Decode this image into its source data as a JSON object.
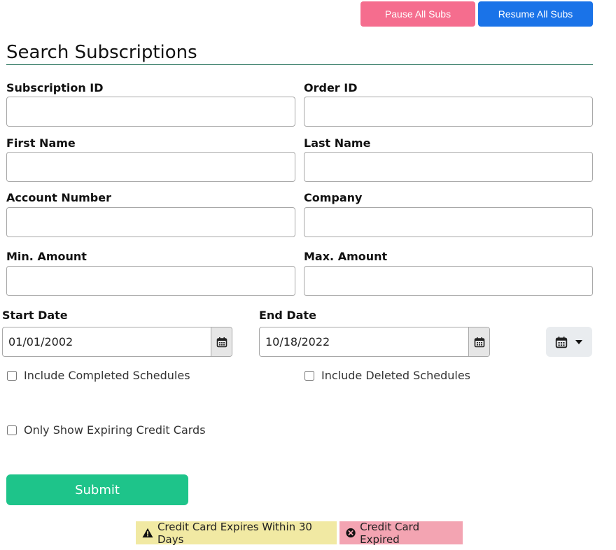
{
  "header": {
    "pause_label": "Pause All Subs",
    "resume_label": "Resume All Subs",
    "title": "Search Subscriptions"
  },
  "fields": {
    "subscription_id": {
      "label": "Subscription ID",
      "value": ""
    },
    "order_id": {
      "label": "Order ID",
      "value": ""
    },
    "first_name": {
      "label": "First Name",
      "value": ""
    },
    "last_name": {
      "label": "Last Name",
      "value": ""
    },
    "account_number": {
      "label": "Account Number",
      "value": ""
    },
    "company": {
      "label": "Company",
      "value": ""
    },
    "min_amount": {
      "label": "Min. Amount",
      "value": ""
    },
    "max_amount": {
      "label": "Max. Amount",
      "value": ""
    },
    "start_date": {
      "label": "Start Date",
      "value": "01/01/2002"
    },
    "end_date": {
      "label": "End Date",
      "value": "10/18/2022"
    }
  },
  "checkboxes": {
    "include_completed": {
      "label": "Include Completed Schedules",
      "checked": false
    },
    "include_deleted": {
      "label": "Include Deleted Schedules",
      "checked": false
    },
    "only_expiring": {
      "label": "Only Show Expiring Credit Cards",
      "checked": false
    }
  },
  "submit_label": "Submit",
  "legend": {
    "expiring_label": "Credit Card Expires Within 30 Days",
    "expired_label": "Credit Card Expired"
  },
  "icons": {
    "calendar": "calendar-icon",
    "caret": "caret-down-icon",
    "warning": "warning-triangle-icon",
    "expired": "x-circle-icon"
  },
  "colors": {
    "pause": "#f56d8e",
    "resume": "#1a73e8",
    "submit": "#1ec48a",
    "legend_warn": "#f1e9a3",
    "legend_expired": "#f3a4b2",
    "rule": "#1b6b52"
  }
}
